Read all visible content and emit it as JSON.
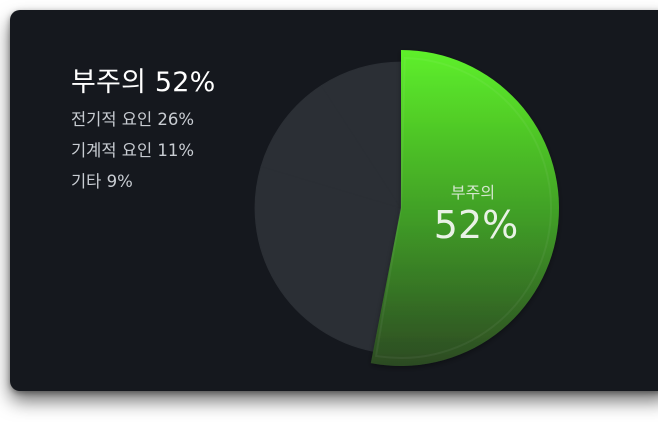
{
  "legend": {
    "title": "부주의 52%",
    "lines": [
      "전기적 요인 26%",
      "기계적 요인 11%",
      "기타 9%"
    ]
  },
  "center_label": {
    "name": "부주의",
    "value": "52%"
  },
  "colors": {
    "highlight_top": "#5ef02a",
    "highlight_bottom": "#2c4a24",
    "rest": "#2b2f35",
    "card": "#15181e"
  },
  "chart_data": {
    "type": "pie",
    "title": "",
    "slices": [
      {
        "label": "부주의",
        "value": 52,
        "highlighted": true
      },
      {
        "label": "전기적 요인",
        "value": 26,
        "highlighted": false
      },
      {
        "label": "기계적 요인",
        "value": 11,
        "highlighted": false
      },
      {
        "label": "기타",
        "value": 9,
        "highlighted": false
      }
    ]
  }
}
